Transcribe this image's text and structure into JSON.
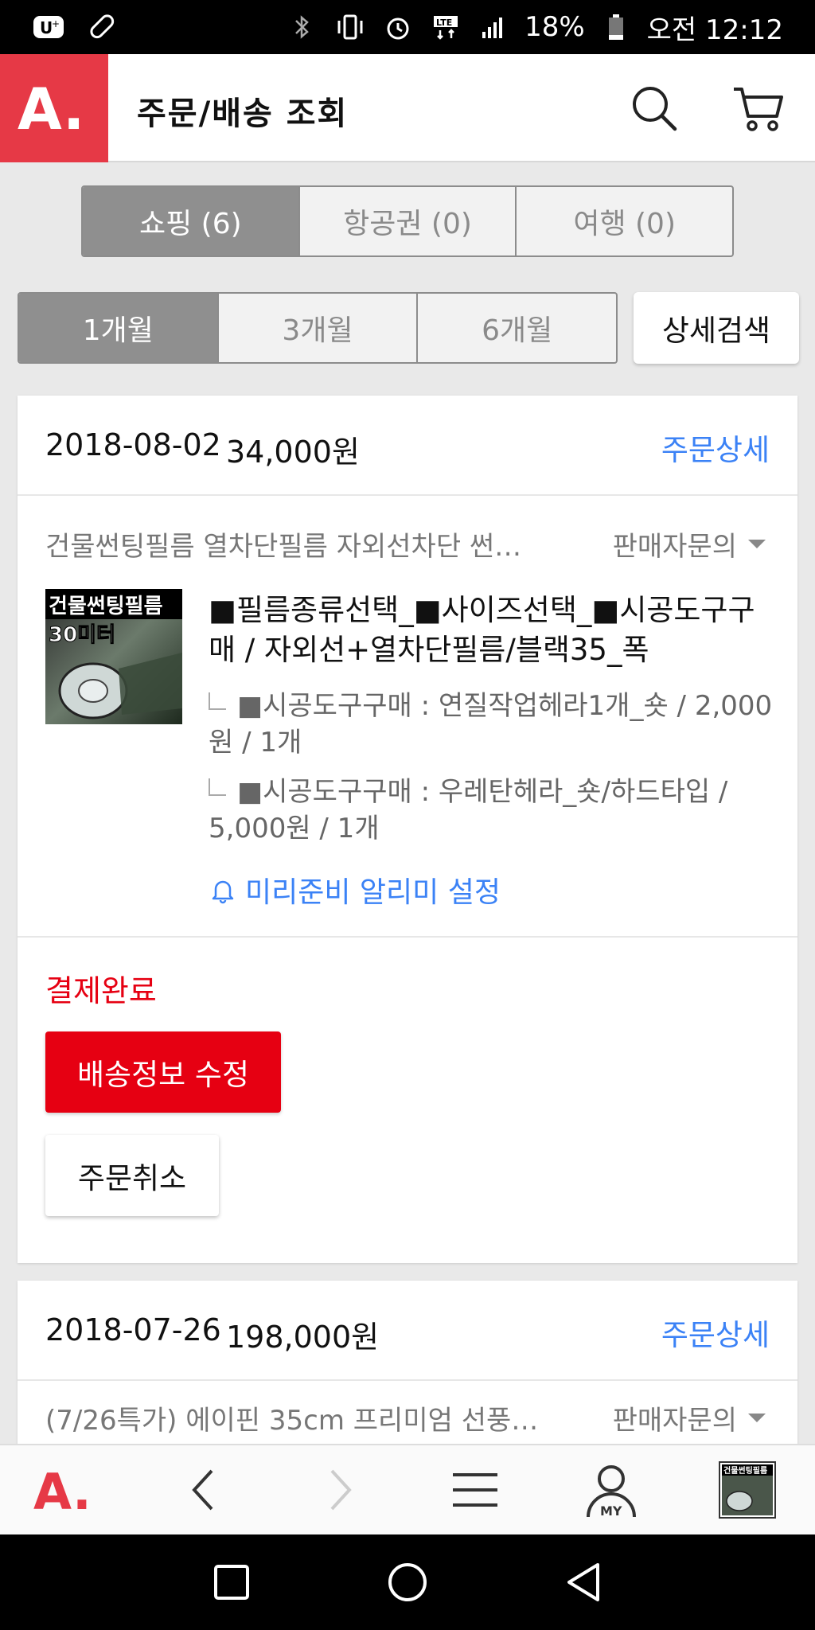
{
  "status_bar": {
    "battery": "18%",
    "time": "오전 12:12",
    "network": "LTE"
  },
  "header": {
    "title": "주문/배송 조회",
    "logo_text": "A."
  },
  "category_tabs": [
    {
      "label": "쇼핑 (6)",
      "active": true
    },
    {
      "label": "항공권 (0)",
      "active": false
    },
    {
      "label": "여행 (0)",
      "active": false
    }
  ],
  "period_tabs": [
    {
      "label": "1개월",
      "active": true
    },
    {
      "label": "3개월",
      "active": false
    },
    {
      "label": "6개월",
      "active": false
    }
  ],
  "detail_search_label": "상세검색",
  "orders": [
    {
      "date": "2018-08-02",
      "amount": "34,000원",
      "detail_link": "주문상세",
      "product_name": "건물썬팅필름 열차단필름 자외선차단 썬…",
      "seller_inquiry": "판매자문의",
      "thumb_text": "건물썬팅필름",
      "thumb_sub": "30미터",
      "option_main": "■필름종류선택_■사이즈선택_■시공도구구매 / 자외선+열차단필름/블랙35_폭",
      "sub_options": [
        "■시공도구구매 : 연질작업헤라1개_숏 / 2,000원 / 1개",
        "■시공도구구매 : 우레탄헤라_숏/하드타입 / 5,000원 / 1개"
      ],
      "alarm_label": "미리준비 알리미 설정",
      "status": "결제완료",
      "btn_edit": "배송정보 수정",
      "btn_cancel": "주문취소"
    },
    {
      "date": "2018-07-26",
      "amount": "198,000원",
      "detail_link": "주문상세",
      "product_name": "(7/26특가) 에이핀 35cm 프리미엄 선풍…",
      "seller_inquiry": "판매자문의"
    }
  ],
  "bottom_nav": {
    "my_label": "MY",
    "recent_thumb_text": "건물썬팅필름"
  },
  "colors": {
    "brand": "#e63946",
    "accent_red": "#e60012",
    "link_blue": "#3b82f6"
  }
}
